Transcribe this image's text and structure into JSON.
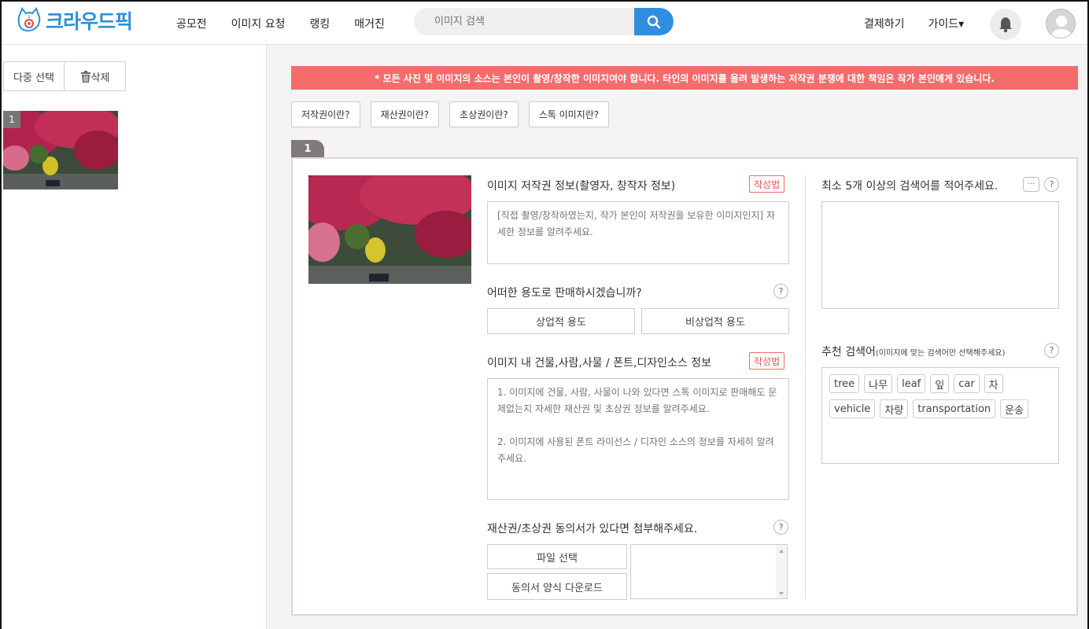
{
  "app": {
    "logo_text": "크라우드픽"
  },
  "nav": {
    "items": [
      "공모전",
      "이미지 요청",
      "랭킹",
      "매거진"
    ]
  },
  "search": {
    "placeholder": "이미지 검색"
  },
  "header_right": {
    "checkout": "결제하기",
    "guide": "가이드▾"
  },
  "sidebar": {
    "multi_select": "다중 선택",
    "delete": "삭제",
    "thumb_number": "1"
  },
  "notice": "* 모든 사진 및 이미지의 소스는 본인이 촬영/창작한 이미지여야 합니다. 타인의 이미지를 올려 발생하는 저작권 분쟁에 대한 책임은 작가 본인에게 있습니다.",
  "info_buttons": [
    "저작권이란?",
    "재산권이란?",
    "초상권이란?",
    "스톡 이미지란?"
  ],
  "tab_label": "1",
  "form": {
    "copyright_label": "이미지 저작권 정보(촬영자, 창작자 정보)",
    "how_to": "작성법",
    "copyright_placeholder": "[직접 촬영/창작하였는지, 작가 본인이 저작권을 보유한 이미지인지] 자세한 정보를 알려주세요.",
    "usage_question": "어떠한 용도로 판매하시겠습니까?",
    "usage_options": [
      "상업적 용도",
      "비상업적 용도"
    ],
    "source_label": "이미지 내 건물,사람,사물 / 폰트,디자인소스 정보",
    "source_placeholder": "1. 이미지에 건물, 사람, 사물이 나와 있다면 스톡 이미지로 판매해도 문제없는지 자세한 재산권 및 초상권 정보를 알려주세요.\n\n2. 이미지에 사용된 폰트 라이선스 / 디자인 소스의 정보를 자세히 알려주세요.",
    "consent_label": "재산권/초상권 동의서가 있다면 첨부해주세요.",
    "file_select": "파일 선택",
    "consent_download": "동의서 양식 다운로드",
    "help_symbol": "?"
  },
  "keywords": {
    "label": "최소 5개 이상의 검색어를 적어주세요.",
    "more": "···",
    "recommended_label": "추천 검색어",
    "recommended_note": "(이미지에 맞는 검색어만 선택해주세요)",
    "recommended": [
      "tree",
      "나무",
      "leaf",
      "잎",
      "car",
      "차",
      "vehicle",
      "차량",
      "transportation",
      "운송"
    ]
  }
}
